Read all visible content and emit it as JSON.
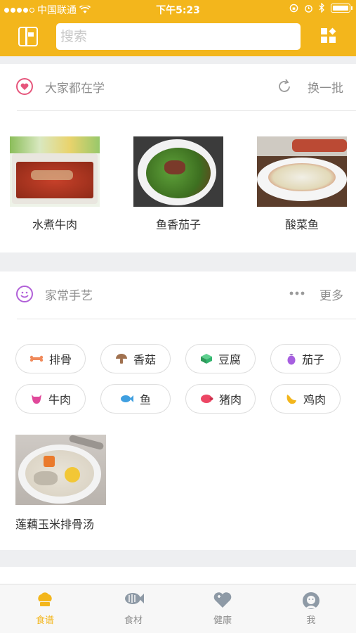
{
  "status_bar": {
    "carrier": "中国联通",
    "time": "下午5:23"
  },
  "header": {
    "search_placeholder": "搜索"
  },
  "section_popular": {
    "title": "大家都在学",
    "action_label": "换一批",
    "dishes": [
      {
        "name": "水煮牛肉"
      },
      {
        "name": "鱼香茄子"
      },
      {
        "name": "酸菜鱼"
      }
    ]
  },
  "section_home": {
    "title": "家常手艺",
    "more_label": "更多",
    "categories": [
      {
        "label": "排骨",
        "icon": "rib-icon",
        "color": "#f08a5b"
      },
      {
        "label": "香菇",
        "icon": "mushroom-icon",
        "color": "#a0714f"
      },
      {
        "label": "豆腐",
        "icon": "tofu-icon",
        "color": "#33b56f"
      },
      {
        "label": "茄子",
        "icon": "eggplant-icon",
        "color": "#a75fe0"
      },
      {
        "label": "牛肉",
        "icon": "beef-icon",
        "color": "#e0489a"
      },
      {
        "label": "鱼",
        "icon": "fish-icon",
        "color": "#3f9fe0"
      },
      {
        "label": "猪肉",
        "icon": "pork-icon",
        "color": "#ec4664"
      },
      {
        "label": "鸡肉",
        "icon": "chicken-icon",
        "color": "#f3b61c"
      }
    ],
    "feature": {
      "name": "莲藕玉米排骨汤"
    }
  },
  "tabs": [
    {
      "label": "食谱",
      "icon": "chef-hat-icon",
      "active": true
    },
    {
      "label": "食材",
      "icon": "fish-bones-icon",
      "active": false
    },
    {
      "label": "健康",
      "icon": "heart-plus-icon",
      "active": false
    },
    {
      "label": "我",
      "icon": "profile-icon",
      "active": false
    }
  ],
  "colors": {
    "accent": "#f3b61c",
    "background": "#eeeff1"
  }
}
